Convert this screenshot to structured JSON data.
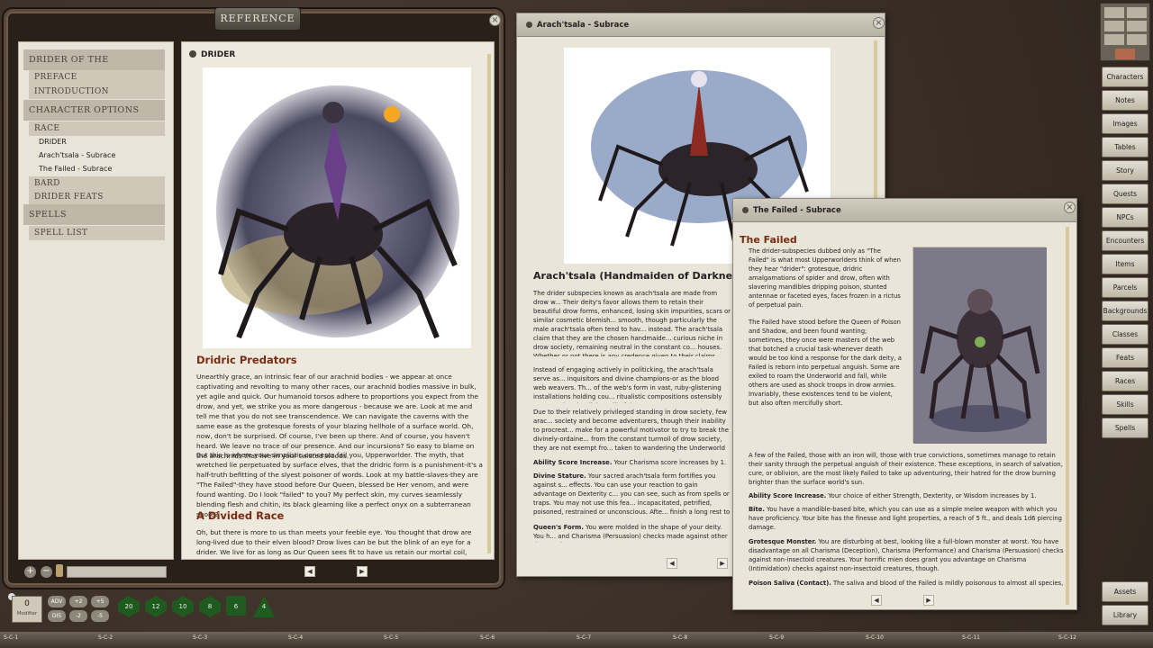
{
  "reference": {
    "title": "REFERENCE",
    "toc": [
      "DRIDER OF THE UNDERWORLD",
      "PREFACE",
      "INTRODUCTION",
      "CHARACTER OPTIONS",
      "RACE",
      "DRIDER",
      "Arach'tsala - Subrace",
      "The Failed - Subrace",
      "BARD",
      "DRIDER FEATS",
      "SPELLS",
      "SPELL LIST"
    ],
    "page_title": "DRIDER",
    "h_predators": "Dridric Predators",
    "p1": "Unearthly grace, an intrinsic fear of our arachnid bodies - we appear at once captivating and revolting to many other races, our arachnid bodies massive in bulk, yet agile and quick. Our humanoid torsos adhere to proportions you expect from the drow, and yet, we strike you as more dangerous - because we are. Look at me and tell me that you do not see transcendence. We can navigate the caverns with the same ease as the grotesque forests of your blazing hellhole of a surface world. Oh, now, don't be surprised. Of course, I've been up there. And of course, you haven't heard. We leave no trace of our presence. And our incursions? So easy to blame on the arachnids that live in your twisted woods.",
    "p2": "But this is where your simplistic concepts fail you, Upperworlder. The myth, that wretched lie perpetuated by surface elves, that the dridric form is a punishment-it's a half-truth befitting of the slyest poisoner of words. Look at my battle-slaves-they are \"The Failed\"-they have stood before Our Queen, blessed be Her venom, and were found wanting. Do I look \"failed\" to you? My perfect skin, my curves seamlessly blending flesh and chitin, its black gleaming like a perfect onyx on a subterranean shore?",
    "h_divided": "A Divided Race",
    "p3": "Oh, but there is more to us than meets your feeble eye. You thought that drow are long-lived due to their elven blood? Drow lives can be but the blink of an eye for a drider. We live for as long as Our Queen sees fit to have us retain our mortal coil, perpetually"
  },
  "arach": {
    "title": "Arach'tsala - Subrace",
    "heading": "Arach'tsala (Handmaiden of Darkness)",
    "p1": "The drider subspecies known as arach'tsala are made from drow w... Their deity's favor allows them to retain their beautiful drow forms, enhanced, losing skin impurities, scars or similar cosmetic blemish... smooth, though particularly the male arach'tsala often tend to hav... instead. The arach'tsala claim that they are the chosen handmaide... curious niche in drow society, remaining neutral in the constant co... houses. Whether or not there is any credence given to their claims... drow society.",
    "p2": "Instead of engaging actively in politicking, the arach'tsala serve as... inquisitors and divine champions-or as the blood web weavers. Th... of the web's form in vast, ruby-glistening installations holding cou... ritualistic compositions ostensibly representing the divine will of th...",
    "p3": "Due to their relatively privileged standing in drow society, few arac... society and become adventurers, though their inability to procreat... make for a powerful motivator to try to break the divinely-ordaine... from the constant turmoil of drow society, they are not exempt fro... taken to wandering the Underworld after a coup.",
    "asi_label": "Ability Score Increase.",
    "asi_text": " Your Charisma score increases by 1.",
    "div_label": "Divine Stature.",
    "div_text": " Your sacred arach'tsala form fortifies you against s... effects. You can use your reaction to gain advantage on Dexterity c... you can see, such as from spells or traps. You may not use this fea... incapacitated, petrified, poisoned, restrained or unconscious. Afte... finish a long rest to do so again.",
    "queen_label": "Queen's Form.",
    "queen_text": " You were molded in the shape of your deity. You h... and Charisma (Persuasion) checks made against other drow and..."
  },
  "failed": {
    "title": "The Failed - Subrace",
    "heading": "The Failed",
    "p1": "The drider-subspecies dubbed only as \"The Failed\" is what most Upperworlders think of when they hear \"drider\": grotesque, dridric amalgamations of spider and drow, often with slavering mandibles dripping poison, stunted antennae or faceted eyes, faces frozen in a rictus of perpetual pain.",
    "p2": "The Failed have stood before the Queen of Poison and Shadow, and been found wanting; sometimes, they once were masters of the web that botched a crucial task-whenever death would be too kind a response for the dark deity, a Failed is reborn into perpetual anguish. Some are exiled to roam the Underworld and fall, while others are used as shock troops in drow armies. Invariably, these existences tend to be violent, but also often mercifully short.",
    "p3": "A few of the Failed, those with an iron will, those with true convictions, sometimes manage to retain their sanity through the perpetual anguish of their existence. These exceptions, in search of salvation, cure, or oblivion, are the most likely Failed to take up adventuring, their hatred for the drow burning brighter than the surface world's sun.",
    "asi_label": "Ability Score Increase.",
    "asi_text": " Your choice of either Strength, Dexterity, or Wisdom increases by 1.",
    "bite_label": "Bite.",
    "bite_text": " You have a mandible-based bite, which you can use as a simple melee weapon with which you have proficiency. Your bite has the finesse and light properties, a reach of 5 ft., and deals 1d6 piercing damage.",
    "gro_label": "Grotesque Monster.",
    "gro_text": " You are disturbing at best, looking like a full-blown monster at worst. You have disadvantage on all Charisma (Deception), Charisma (Performance) and Charisma (Persuasion) checks against non-insectoid creatures. Your horrific mien does grant you advantage on Charisma (Intimidation) checks against non-insectoid creatures, though.",
    "poi_label": "Poison Saliva (Contact).",
    "poi_text": " The saliva and blood of the Failed is mildly poisonous to almost all species,"
  },
  "sidebar": [
    "Characters",
    "Notes",
    "Images",
    "Tables",
    "Story",
    "Quests",
    "NPCs",
    "Encounters",
    "Items",
    "Parcels",
    "Backgrounds",
    "Classes",
    "Feats",
    "Races",
    "Skills",
    "Spells"
  ],
  "sidebar_bottom": [
    "Assets",
    "Library"
  ],
  "dice_bar": {
    "modifier_value": "0",
    "modifier_label": "Modifier",
    "adv": "ADV",
    "dis": "DIS",
    "plus2": "+2",
    "plus5": "+5",
    "minus2": "-2",
    "minus5": "-5",
    "dice": [
      "20",
      "12",
      "10",
      "8",
      "6",
      "4"
    ]
  },
  "hotkeys": [
    "S-C-1",
    "S-C-2",
    "S-C-3",
    "S-C-4",
    "S-C-5",
    "S-C-6",
    "S-C-7",
    "S-C-8",
    "S-C-9",
    "S-C-10",
    "S-C-11",
    "S-C-12"
  ],
  "icons": {
    "close": "close-icon",
    "prev": "prev-arrow-icon",
    "next": "next-arrow-icon"
  }
}
